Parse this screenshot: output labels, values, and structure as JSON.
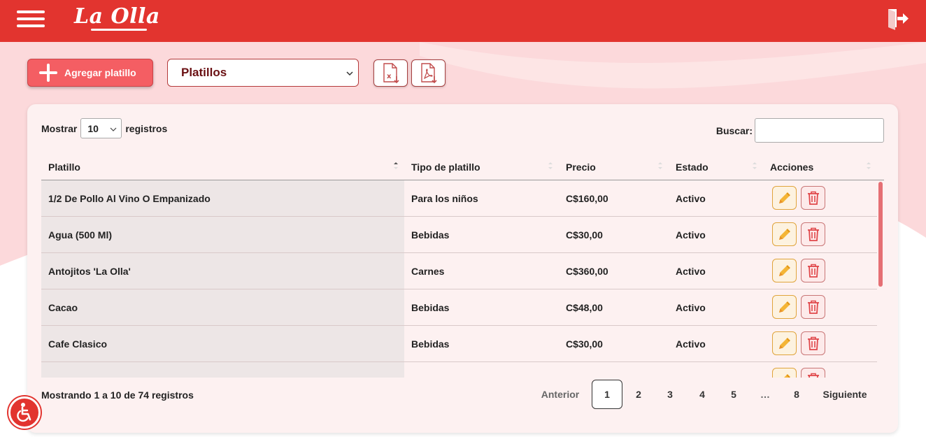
{
  "header": {
    "logo_text": "La Olla",
    "menu_icon": "hamburger-icon",
    "logout_icon": "logout-icon"
  },
  "toolbar": {
    "add_label": "Agregar platillo",
    "category_selected": "Platillos",
    "export_excel_icon": "excel-file-icon",
    "export_pdf_icon": "pdf-file-icon"
  },
  "table_controls": {
    "show_label": "Mostrar",
    "page_length": "10",
    "records_label": "registros",
    "search_label": "Buscar:",
    "search_value": ""
  },
  "table": {
    "headers": [
      "Platillo",
      "Tipo de platillo",
      "Precio",
      "Estado",
      "Acciones"
    ],
    "rows": [
      {
        "platillo": "1/2 De Pollo Al Vino O Empanizado",
        "tipo": "Para los niños",
        "precio": "C$160,00",
        "estado": "Activo"
      },
      {
        "platillo": "Agua (500 Ml)",
        "tipo": "Bebidas",
        "precio": "C$30,00",
        "estado": "Activo"
      },
      {
        "platillo": "Antojitos 'La Olla'",
        "tipo": "Carnes",
        "precio": "C$360,00",
        "estado": "Activo"
      },
      {
        "platillo": "Cacao",
        "tipo": "Bebidas",
        "precio": "C$48,00",
        "estado": "Activo"
      },
      {
        "platillo": "Cafe Clasico",
        "tipo": "Bebidas",
        "precio": "C$30,00",
        "estado": "Activo"
      },
      {
        "platillo": "",
        "tipo": "",
        "precio": "",
        "estado": ""
      }
    ]
  },
  "footer": {
    "info": "Mostrando 1 a 10 de 74 registros",
    "prev": "Anterior",
    "next": "Siguiente",
    "pages": [
      "1",
      "2",
      "3",
      "4",
      "5",
      "…",
      "8"
    ],
    "current_page": "1"
  },
  "colors": {
    "brand": "#e2342f",
    "accent": "#f45e63",
    "edit": "#f4b536",
    "delete": "#e0474a"
  }
}
